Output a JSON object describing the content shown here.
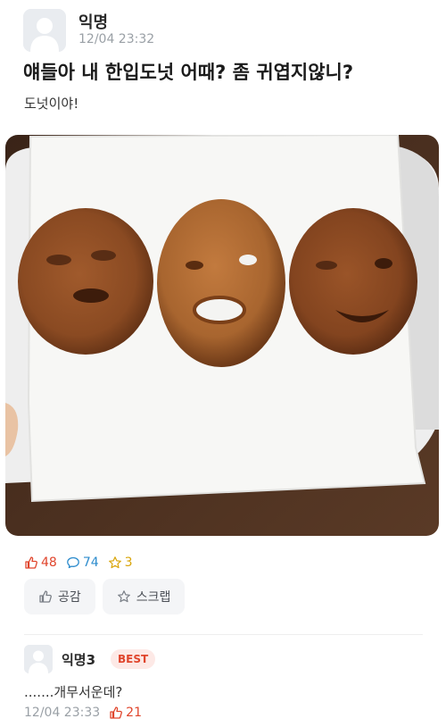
{
  "post": {
    "author": "익명",
    "time": "12/04 23:32",
    "title": "얘들아 내 한입도넛 어때? 좀 귀엽지않니?",
    "body": "도넛이야!"
  },
  "stats": {
    "likes": "48",
    "comments": "74",
    "scraps": "3"
  },
  "actions": {
    "like_label": "공감",
    "scrap_label": "스크랩"
  },
  "comment": {
    "author": "익명3",
    "badge": "BEST",
    "text": ".......개무서운데?",
    "time": "12/04 23:33",
    "likes": "21"
  },
  "icons": {
    "like": "thumbs-up-icon",
    "comment": "speech-bubble-icon",
    "scrap": "star-icon",
    "avatar": "default-user-avatar"
  },
  "colors": {
    "like": "#e0452c",
    "comment": "#2d8ccd",
    "scrap": "#d9a50a",
    "best_badge_bg": "#fde9e6"
  }
}
